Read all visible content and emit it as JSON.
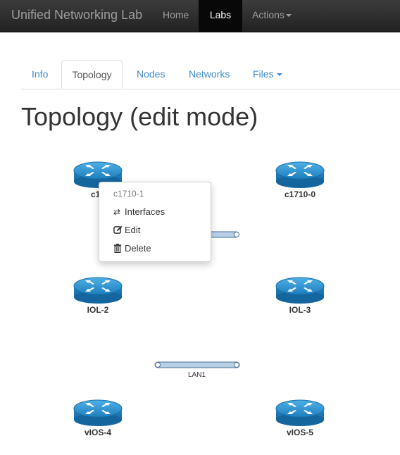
{
  "navbar": {
    "brand": "Unified Networking Lab",
    "home": "Home",
    "labs": "Labs",
    "actions": "Actions"
  },
  "tabs": {
    "info": "Info",
    "topology": "Topology",
    "nodes": "Nodes",
    "networks": "Networks",
    "files": "Files"
  },
  "page_title": "Topology (edit mode)",
  "nodes": {
    "c1710_1": "c17",
    "c1710_0": "c1710-0",
    "iol_2": "IOL-2",
    "iol_3": "IOL-3",
    "vios_4": "vIOS-4",
    "vios_5": "vIOS-5"
  },
  "networks": {
    "lan1": "LAN1"
  },
  "context_menu": {
    "header": "c1710-1",
    "interfaces": "Interfaces",
    "edit": "Edit",
    "delete": "Delete"
  },
  "colors": {
    "router_blue": "#2f8fc9",
    "link": "#428bca",
    "navbar": "#222222"
  }
}
